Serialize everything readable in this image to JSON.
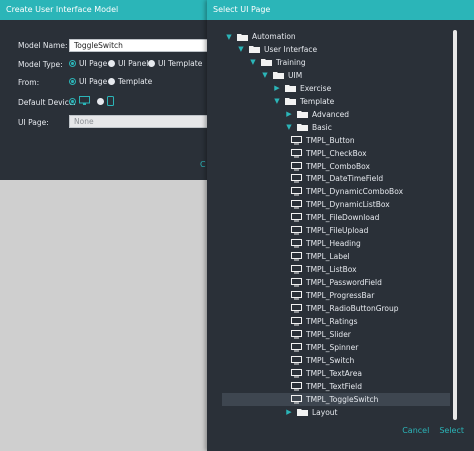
{
  "background_dialog": {
    "title": "Create User Interface Model",
    "model_name_label": "Model Name:",
    "model_name_value": "ToggleSwitch",
    "model_type_label": "Model Type:",
    "model_type_options": [
      "UI Page",
      "UI Panel",
      "UI Template"
    ],
    "model_type_selected": "UI Page",
    "from_label": "From:",
    "from_options": [
      "UI Page",
      "Template"
    ],
    "from_selected": "UI Page",
    "default_device_label": "Default Device:",
    "default_device_options": [
      "desktop-icon",
      "phone-icon"
    ],
    "default_device_selected": "desktop-icon",
    "ui_page_label": "UI Page:",
    "ui_page_placeholder": "None",
    "cancel_peek": "C"
  },
  "modal": {
    "title": "Select UI Page",
    "tree": [
      {
        "label": "Automation",
        "depth": 0,
        "expanded": true,
        "folder": true
      },
      {
        "label": "User Interface",
        "depth": 1,
        "expanded": true,
        "folder": true
      },
      {
        "label": "Training",
        "depth": 2,
        "expanded": true,
        "folder": true
      },
      {
        "label": "UIM",
        "depth": 3,
        "expanded": true,
        "folder": true
      },
      {
        "label": "Exercise",
        "depth": 4,
        "expanded": false,
        "folder": true
      },
      {
        "label": "Template",
        "depth": 4,
        "expanded": true,
        "folder": true
      },
      {
        "label": "Advanced",
        "depth": 5,
        "expanded": false,
        "folder": true
      },
      {
        "label": "Basic",
        "depth": 5,
        "expanded": true,
        "folder": true
      },
      {
        "label": "TMPL_Button",
        "depth": 6,
        "folder": false
      },
      {
        "label": "TMPL_CheckBox",
        "depth": 6,
        "folder": false
      },
      {
        "label": "TMPL_ComboBox",
        "depth": 6,
        "folder": false
      },
      {
        "label": "TMPL_DateTimeField",
        "depth": 6,
        "folder": false
      },
      {
        "label": "TMPL_DynamicComboBox",
        "depth": 6,
        "folder": false
      },
      {
        "label": "TMPL_DynamicListBox",
        "depth": 6,
        "folder": false
      },
      {
        "label": "TMPL_FileDownload",
        "depth": 6,
        "folder": false
      },
      {
        "label": "TMPL_FileUpload",
        "depth": 6,
        "folder": false
      },
      {
        "label": "TMPL_Heading",
        "depth": 6,
        "folder": false
      },
      {
        "label": "TMPL_Label",
        "depth": 6,
        "folder": false
      },
      {
        "label": "TMPL_ListBox",
        "depth": 6,
        "folder": false
      },
      {
        "label": "TMPL_PasswordField",
        "depth": 6,
        "folder": false
      },
      {
        "label": "TMPL_ProgressBar",
        "depth": 6,
        "folder": false
      },
      {
        "label": "TMPL_RadioButtonGroup",
        "depth": 6,
        "folder": false
      },
      {
        "label": "TMPL_Ratings",
        "depth": 6,
        "folder": false
      },
      {
        "label": "TMPL_Slider",
        "depth": 6,
        "folder": false
      },
      {
        "label": "TMPL_Spinner",
        "depth": 6,
        "folder": false
      },
      {
        "label": "TMPL_Switch",
        "depth": 6,
        "folder": false
      },
      {
        "label": "TMPL_TextArea",
        "depth": 6,
        "folder": false
      },
      {
        "label": "TMPL_TextField",
        "depth": 6,
        "folder": false
      },
      {
        "label": "TMPL_ToggleSwitch",
        "depth": 6,
        "folder": false,
        "selected": true
      },
      {
        "label": "Layout",
        "depth": 5,
        "expanded": false,
        "folder": true
      }
    ],
    "cancel_label": "Cancel",
    "select_label": "Select"
  },
  "colors": {
    "accent": "#2bb5b8",
    "panel": "#2a3038",
    "selected_row": "#3e4650"
  }
}
